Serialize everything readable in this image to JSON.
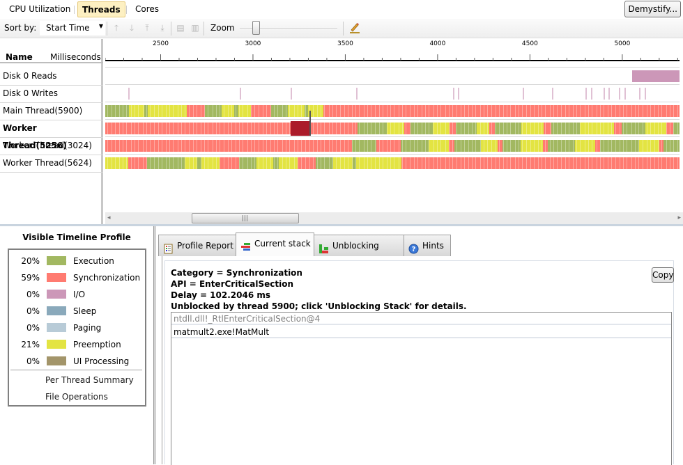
{
  "view_tabs": [
    {
      "label": "CPU Utilization",
      "active": false
    },
    {
      "label": "Threads",
      "active": true
    },
    {
      "label": "Cores",
      "active": false
    }
  ],
  "demystify_label": "Demystify...",
  "toolbar": {
    "sort_label": "Sort by:",
    "sort_value": "Start Time",
    "icons": [
      "move-up-icon",
      "move-down-icon",
      "move-top-icon",
      "move-bottom-icon",
      "expand-icon",
      "collapse-icon"
    ],
    "zoom_label": "Zoom",
    "zoom_level": 0.15
  },
  "timeline": {
    "name_header": "Name",
    "units_header": "Milliseconds",
    "axis": {
      "min": 2200,
      "max": 5310,
      "labels": [
        "2500",
        "3000",
        "3500",
        "4000",
        "4500",
        "5000"
      ],
      "major_step": 500,
      "minor_step": 100
    },
    "colors": {
      "execution": "#a2b861",
      "synchronization": "#ff7b71",
      "io": "#cc97b8",
      "sleep": "#8aa9bb",
      "paging": "#b8cbd7",
      "preemption": "#e3e442",
      "ui_processing": "#a3956a",
      "selected": "#ab1b2a"
    },
    "rows": [
      {
        "label": "Disk 0 Reads",
        "bold": false,
        "kind": "io",
        "segments": [
          [
            5055,
            5310,
            "io"
          ]
        ]
      },
      {
        "label": "Disk 0 Writes",
        "bold": false,
        "kind": "io",
        "ticks": [
          2325,
          2930,
          3205,
          3560,
          4085,
          4110,
          4460,
          4620,
          4800,
          4830,
          4900,
          4925,
          4980,
          5010,
          5090,
          5120
        ]
      },
      {
        "label": "Main Thread(5900)",
        "bold": false,
        "segments": [
          [
            2200,
            2330,
            "execution"
          ],
          [
            2330,
            2410,
            "preemption"
          ],
          [
            2410,
            2430,
            "execution"
          ],
          [
            2430,
            2640,
            "preemption"
          ],
          [
            2640,
            2740,
            "synchronization"
          ],
          [
            2740,
            2830,
            "execution"
          ],
          [
            2830,
            2900,
            "preemption"
          ],
          [
            2900,
            2920,
            "execution"
          ],
          [
            2920,
            2990,
            "preemption"
          ],
          [
            2990,
            3100,
            "synchronization"
          ],
          [
            3100,
            3190,
            "execution"
          ],
          [
            3190,
            3280,
            "preemption"
          ],
          [
            3280,
            3300,
            "execution"
          ],
          [
            3300,
            3380,
            "preemption"
          ],
          [
            3380,
            5310,
            "synchronization"
          ]
        ]
      },
      {
        "label": "Worker Thread(5256)",
        "bold": true,
        "segments": [
          [
            2200,
            3205,
            "synchronization"
          ],
          [
            3205,
            3305,
            "selected"
          ],
          [
            3305,
            3565,
            "synchronization"
          ],
          [
            3565,
            3725,
            "execution"
          ],
          [
            3725,
            3820,
            "preemption"
          ],
          [
            3820,
            3855,
            "synchronization"
          ],
          [
            3855,
            3975,
            "execution"
          ],
          [
            3975,
            4065,
            "preemption"
          ],
          [
            4065,
            4100,
            "synchronization"
          ],
          [
            4100,
            4210,
            "execution"
          ],
          [
            4210,
            4280,
            "preemption"
          ],
          [
            4280,
            4310,
            "synchronization"
          ],
          [
            4310,
            4455,
            "execution"
          ],
          [
            4455,
            4575,
            "preemption"
          ],
          [
            4575,
            4615,
            "synchronization"
          ],
          [
            4615,
            4770,
            "execution"
          ],
          [
            4770,
            4955,
            "preemption"
          ],
          [
            4955,
            4995,
            "synchronization"
          ],
          [
            4995,
            5125,
            "execution"
          ],
          [
            5125,
            5240,
            "preemption"
          ],
          [
            5240,
            5275,
            "synchronization"
          ],
          [
            5275,
            5310,
            "execution"
          ]
        ]
      },
      {
        "label": "Worker Thread(3024)",
        "bold": false,
        "segments": [
          [
            2200,
            3535,
            "synchronization"
          ],
          [
            3535,
            3670,
            "execution"
          ],
          [
            3670,
            3800,
            "synchronization"
          ],
          [
            3800,
            3950,
            "execution"
          ],
          [
            3950,
            4060,
            "preemption"
          ],
          [
            4060,
            4090,
            "synchronization"
          ],
          [
            4090,
            4235,
            "execution"
          ],
          [
            4235,
            4325,
            "preemption"
          ],
          [
            4325,
            4350,
            "synchronization"
          ],
          [
            4350,
            4450,
            "execution"
          ],
          [
            4450,
            4570,
            "preemption"
          ],
          [
            4570,
            4595,
            "synchronization"
          ],
          [
            4595,
            4745,
            "execution"
          ],
          [
            4745,
            4855,
            "preemption"
          ],
          [
            4855,
            4880,
            "synchronization"
          ],
          [
            4880,
            5090,
            "execution"
          ],
          [
            5090,
            5200,
            "preemption"
          ],
          [
            5200,
            5225,
            "synchronization"
          ],
          [
            5225,
            5370,
            "execution"
          ],
          [
            5370,
            5310,
            "preemption"
          ]
        ]
      },
      {
        "label": "Worker Thread(5624)",
        "bold": false,
        "segments": [
          [
            2200,
            2325,
            "preemption"
          ],
          [
            2325,
            2425,
            "synchronization"
          ],
          [
            2425,
            2630,
            "execution"
          ],
          [
            2630,
            2700,
            "preemption"
          ],
          [
            2700,
            2720,
            "execution"
          ],
          [
            2720,
            2820,
            "preemption"
          ],
          [
            2820,
            2925,
            "synchronization"
          ],
          [
            2925,
            3020,
            "execution"
          ],
          [
            3020,
            3110,
            "preemption"
          ],
          [
            3110,
            3140,
            "execution"
          ],
          [
            3140,
            3240,
            "preemption"
          ],
          [
            3240,
            3340,
            "synchronization"
          ],
          [
            3340,
            3435,
            "execution"
          ],
          [
            3435,
            3540,
            "preemption"
          ],
          [
            3540,
            3560,
            "execution"
          ],
          [
            3560,
            3600,
            "preemption"
          ],
          [
            3600,
            3805,
            "preemption"
          ],
          [
            3805,
            5310,
            "synchronization"
          ]
        ]
      }
    ]
  },
  "profile": {
    "title": "Visible Timeline Profile",
    "legend": [
      {
        "pct": "20%",
        "label": "Execution",
        "color": "#a2b861"
      },
      {
        "pct": "59%",
        "label": "Synchronization",
        "color": "#ff7b71"
      },
      {
        "pct": "0%",
        "label": "I/O",
        "color": "#cc97b8"
      },
      {
        "pct": "0%",
        "label": "Sleep",
        "color": "#8aa9bb"
      },
      {
        "pct": "0%",
        "label": "Paging",
        "color": "#b8cbd7"
      },
      {
        "pct": "21%",
        "label": "Preemption",
        "color": "#e3e442"
      },
      {
        "pct": "0%",
        "label": "UI Processing",
        "color": "#a3956a"
      }
    ],
    "links": [
      "Per Thread Summary",
      "File Operations"
    ]
  },
  "detail_tabs": [
    {
      "label": "Profile Report",
      "icon": "report-icon",
      "active": false
    },
    {
      "label": "Current stack",
      "icon": "stack-icon",
      "active": true
    },
    {
      "label": "Unblocking stack",
      "icon": "unblocking-stack-icon",
      "active": false
    },
    {
      "label": "Hints",
      "icon": "help-icon",
      "active": false
    }
  ],
  "current_stack": {
    "lines": [
      "Category = Synchronization",
      "API = EnterCriticalSection",
      "Delay = 102.2046 ms",
      "Unblocked by thread 5900; click 'Unblocking Stack' for details."
    ],
    "copy_label": "Copy",
    "frames": [
      {
        "text": "ntdll.dll!_RtlEnterCriticalSection@4",
        "dim": true
      },
      {
        "text": "matmult2.exe!MatMult",
        "dim": false
      }
    ]
  }
}
